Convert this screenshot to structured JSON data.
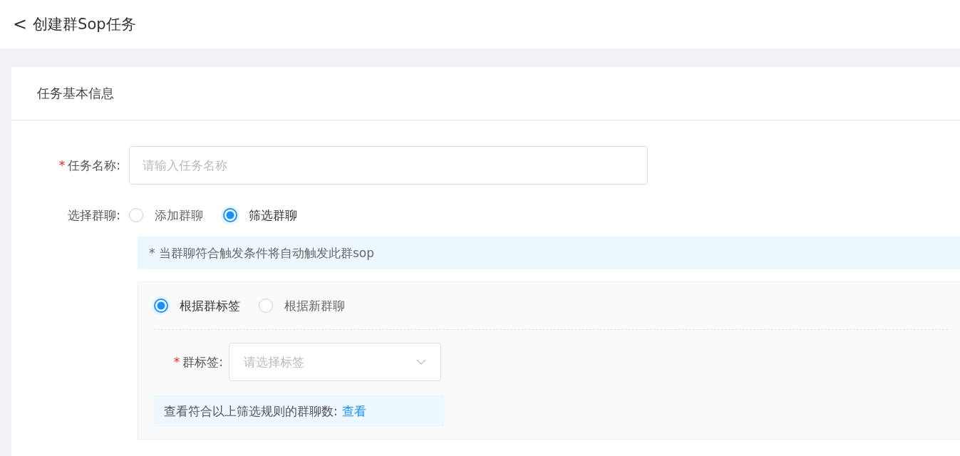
{
  "header": {
    "back_icon": "<",
    "title": "创建群Sop任务"
  },
  "card": {
    "title": "任务基本信息"
  },
  "task_name": {
    "label": "任务名称:",
    "required_mark": "*",
    "placeholder": "请输入任务名称"
  },
  "group_select": {
    "label": "选择群聊:",
    "options": [
      {
        "label": "添加群聊",
        "selected": false
      },
      {
        "label": "筛选群聊",
        "selected": true
      }
    ]
  },
  "notice": "* 当群聊符合触发条件将自动触发此群sop",
  "filter": {
    "modes": [
      {
        "label": "根据群标签",
        "selected": true
      },
      {
        "label": "根据新群聊",
        "selected": false
      }
    ],
    "tag": {
      "label": "群标签:",
      "required_mark": "*",
      "placeholder": "请选择标签"
    },
    "count": {
      "text": "查看符合以上筛选规则的群聊数:",
      "link": "查看"
    }
  }
}
